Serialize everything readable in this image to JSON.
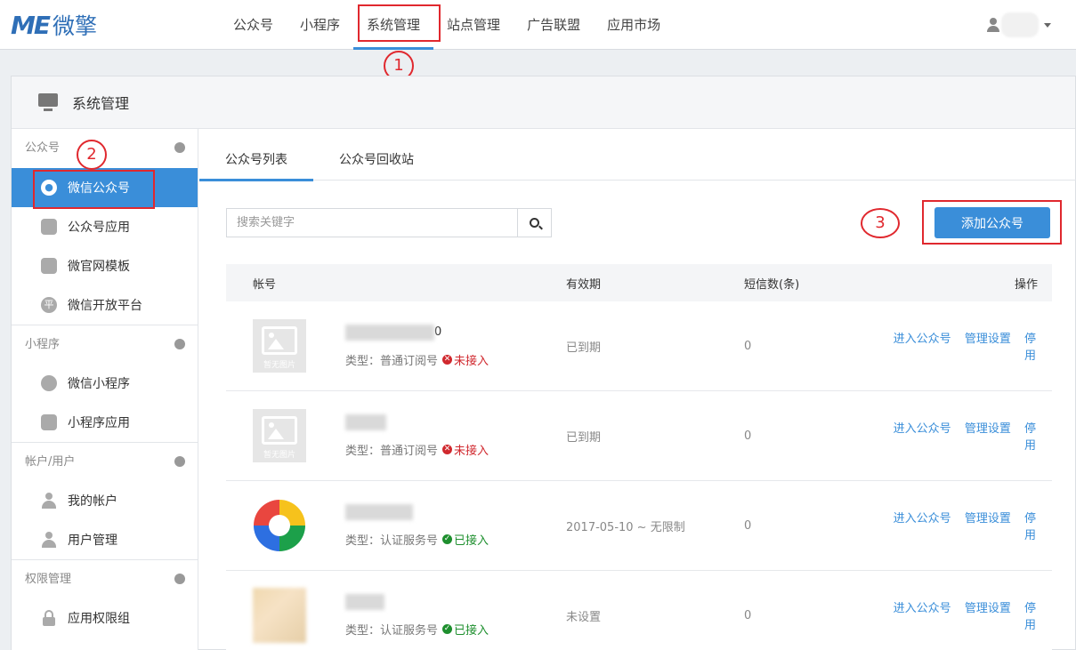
{
  "brand": {
    "logo_latin": "ME",
    "logo_cn": "微擎",
    "color": "#2f6fb7"
  },
  "nav": [
    "公众号",
    "小程序",
    "系统管理",
    "站点管理",
    "广告联盟",
    "应用市场"
  ],
  "panel": {
    "title": "系统管理"
  },
  "sidebar": {
    "groups": [
      {
        "label": "公众号",
        "items": [
          "微信公众号",
          "公众号应用",
          "微官网模板",
          "微信开放平台"
        ]
      },
      {
        "label": "小程序",
        "items": [
          "微信小程序",
          "小程序应用"
        ]
      },
      {
        "label": "帐户/用户",
        "items": [
          "我的帐户",
          "用户管理"
        ]
      },
      {
        "label": "权限管理",
        "items": [
          "应用权限组"
        ]
      }
    ],
    "icon_glyph_ping": "平"
  },
  "tabs": [
    "公众号列表",
    "公众号回收站"
  ],
  "search": {
    "placeholder": "搜索关键字"
  },
  "add_button": "添加公众号",
  "table": {
    "headers": {
      "account": "帐号",
      "expiry": "有效期",
      "sms": "短信数(条)",
      "ops": "操作"
    },
    "rows": [
      {
        "name_tail": "0",
        "type": "类型：普通订阅号",
        "status": "未接入",
        "expiry": "已到期",
        "sms": "0",
        "thumb_caption": "暂无图片"
      },
      {
        "name_tail": "",
        "type": "类型：普通订阅号",
        "status": "未接入",
        "expiry": "已到期",
        "sms": "0",
        "thumb_caption": "暂无图片"
      },
      {
        "name_tail": "",
        "type": "类型：认证服务号",
        "status": "已接入",
        "expiry": "2017-05-10 ~ 无限制",
        "sms": "0",
        "thumb_caption": ""
      },
      {
        "name_tail": "",
        "type": "类型：认证服务号",
        "status": "已接入",
        "expiry": "未设置",
        "sms": "0",
        "thumb_caption": ""
      }
    ],
    "ops": [
      "进入公众号",
      "管理设置",
      "停用"
    ]
  },
  "annotations": [
    "1",
    "2",
    "3"
  ],
  "colors": {
    "accent": "#3a8ed9",
    "annotation": "#e0282e",
    "error": "#d0282e",
    "success": "#1e8f2e"
  }
}
